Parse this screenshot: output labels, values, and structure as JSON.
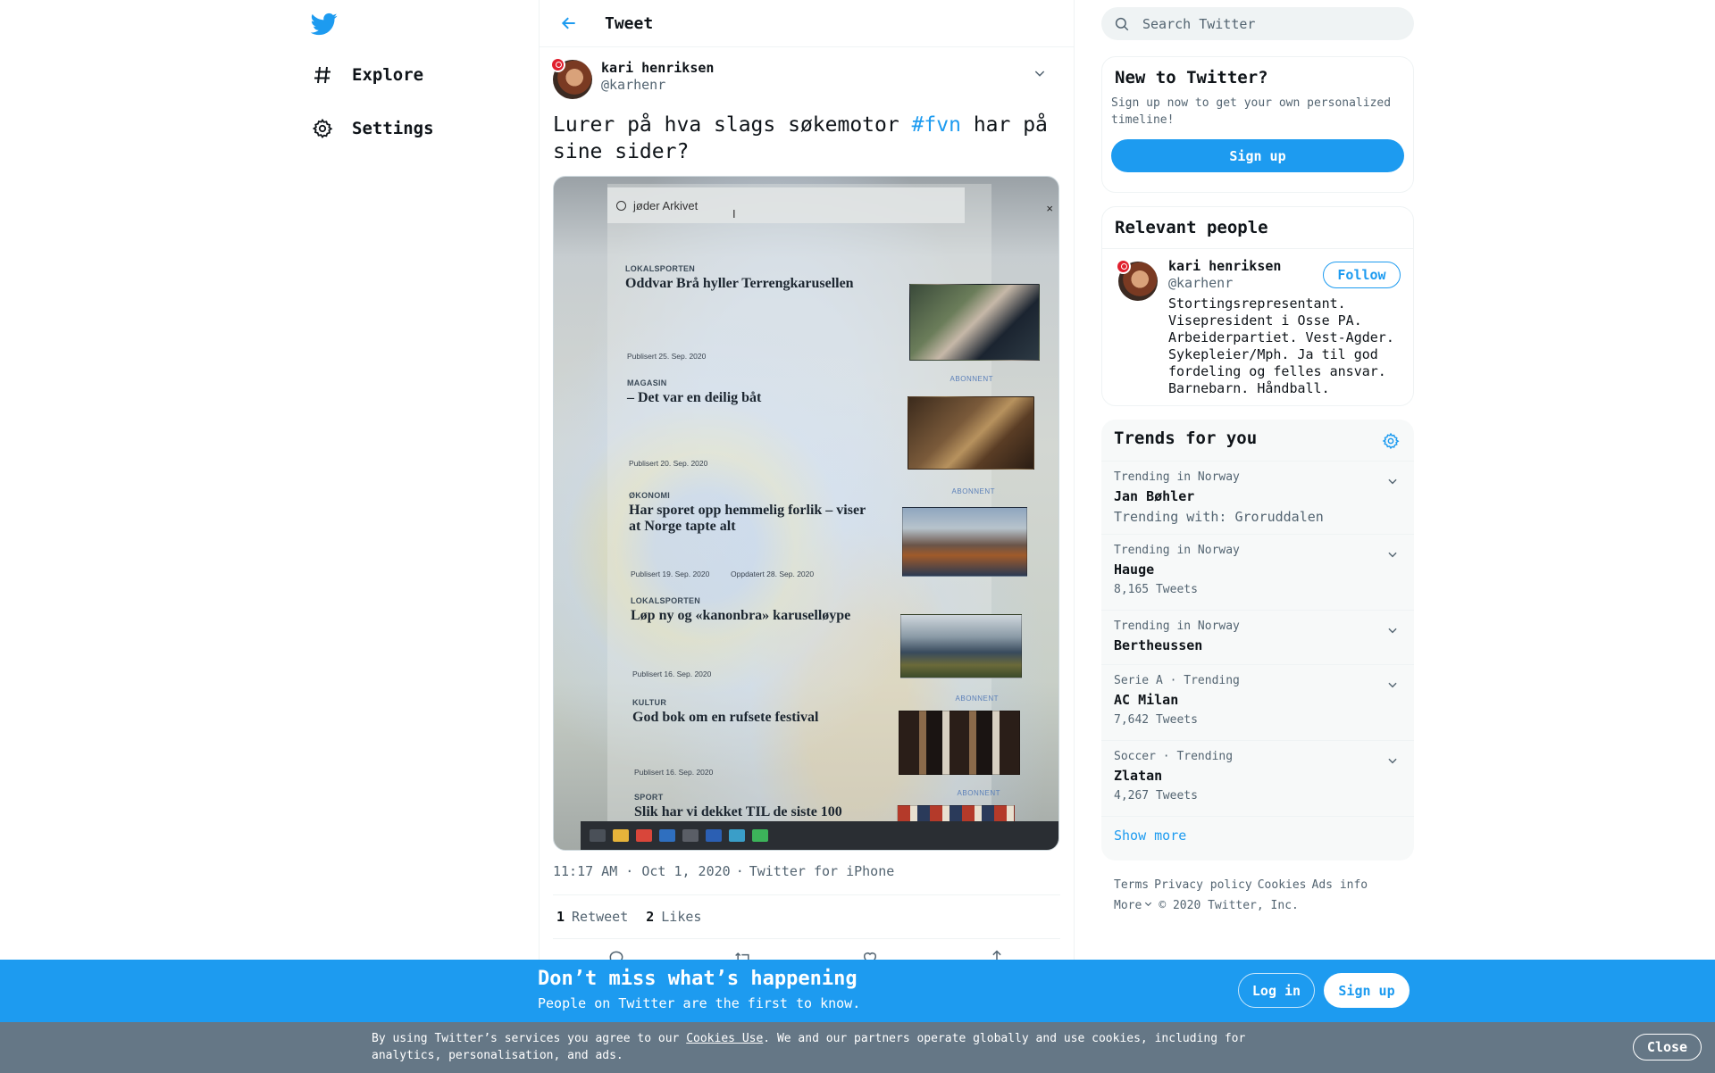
{
  "nav": {
    "logo_icon": "twitter-bird-icon",
    "items": [
      {
        "label": "Explore",
        "icon": "hashtag-icon"
      },
      {
        "label": "Settings",
        "icon": "gear-icon"
      }
    ]
  },
  "header": {
    "title": "Tweet",
    "back_icon": "arrow-left-icon"
  },
  "tweet": {
    "author_name": "kari henriksen",
    "author_handle": "@karhenr",
    "text_before": "Lurer på hva slags søkemotor ",
    "hashtag": "#fvn",
    "text_after": " har på sine sider?",
    "image": {
      "search_text": "jøder Arkivet",
      "close_glyph": "×",
      "articles": [
        {
          "section": "LOKALSPORTEN",
          "headline": "Oddvar Brå hyller Terrengkarusellen",
          "published": "Publisert 25. Sep. 2020",
          "updated": "",
          "badge": ""
        },
        {
          "section": "MAGASIN",
          "headline": "– Det var en deilig båt",
          "published": "Publisert 20. Sep. 2020",
          "updated": "",
          "badge": "ABONNENT"
        },
        {
          "section": "ØKONOMI",
          "headline": "Har sporet opp hemmelig forlik – viser at Norge tapte alt",
          "published": "Publisert 19. Sep. 2020",
          "updated": "Oppdatert 28. Sep. 2020",
          "badge": "ABONNENT"
        },
        {
          "section": "LOKALSPORTEN",
          "headline": "Løp ny og «kanonbra» karuselløype",
          "published": "Publisert 16. Sep. 2020",
          "updated": "",
          "badge": ""
        },
        {
          "section": "KULTUR",
          "headline": "God bok om en rufsete festival",
          "published": "Publisert 16. Sep. 2020",
          "updated": "",
          "badge": "ABONNENT"
        },
        {
          "section": "SPORT",
          "headline": "Slik har vi dekket TIL de siste 100",
          "published": "",
          "updated": "",
          "badge": "ABONNENT"
        }
      ]
    },
    "time": "11:17 AM · Oct 1, 2020",
    "separator": "·",
    "source": "Twitter for iPhone",
    "retweets_count": "1",
    "retweets_label": "Retweet",
    "likes_count": "2",
    "likes_label": "Likes"
  },
  "search": {
    "placeholder": "Search Twitter"
  },
  "signup_card": {
    "title": "New to Twitter?",
    "description": "Sign up now to get your own personalized timeline!",
    "button": "Sign up"
  },
  "relevant_people": {
    "title": "Relevant people",
    "person": {
      "name": "kari henriksen",
      "handle": "@karhenr",
      "follow_label": "Follow",
      "bio": "Stortingsrepresentant. Visepresident i Osse PA. Arbeiderpartiet. Vest-Agder. Sykepleier/Mph. Ja til god fordeling og felles ansvar. Barnebarn. Håndball."
    }
  },
  "trends": {
    "title": "Trends for you",
    "items": [
      {
        "context": "Trending in Norway",
        "name": "Jan Bøhler",
        "sub": "Trending with: Groruddalen"
      },
      {
        "context": "Trending in Norway",
        "name": "Hauge",
        "sub": "8,165 Tweets"
      },
      {
        "context": "Trending in Norway",
        "name": "Bertheussen",
        "sub": ""
      },
      {
        "context": "Serie A · Trending",
        "name": "AC Milan",
        "sub": "7,642 Tweets"
      },
      {
        "context": "Soccer · Trending",
        "name": "Zlatan",
        "sub": "4,267 Tweets"
      }
    ],
    "show_more": "Show more"
  },
  "footer": {
    "links": [
      "Terms",
      "Privacy policy",
      "Cookies",
      "Ads info"
    ],
    "more": "More",
    "copyright": "© 2020 Twitter, Inc."
  },
  "bottom_bar": {
    "title": "Don’t miss what’s happening",
    "subtitle": "People on Twitter are the first to know.",
    "login": "Log in",
    "signup": "Sign up"
  },
  "cookie_bar": {
    "text_before": "By using Twitter’s services you agree to our ",
    "link": "Cookies Use",
    "text_after": ". We and our partners operate globally and use cookies, including for analytics, personalisation, and ads.",
    "close": "Close"
  },
  "colors": {
    "accent": "#1d9bf0",
    "text": "#0f1419",
    "muted": "#536471",
    "cookie_bg": "#657786"
  }
}
